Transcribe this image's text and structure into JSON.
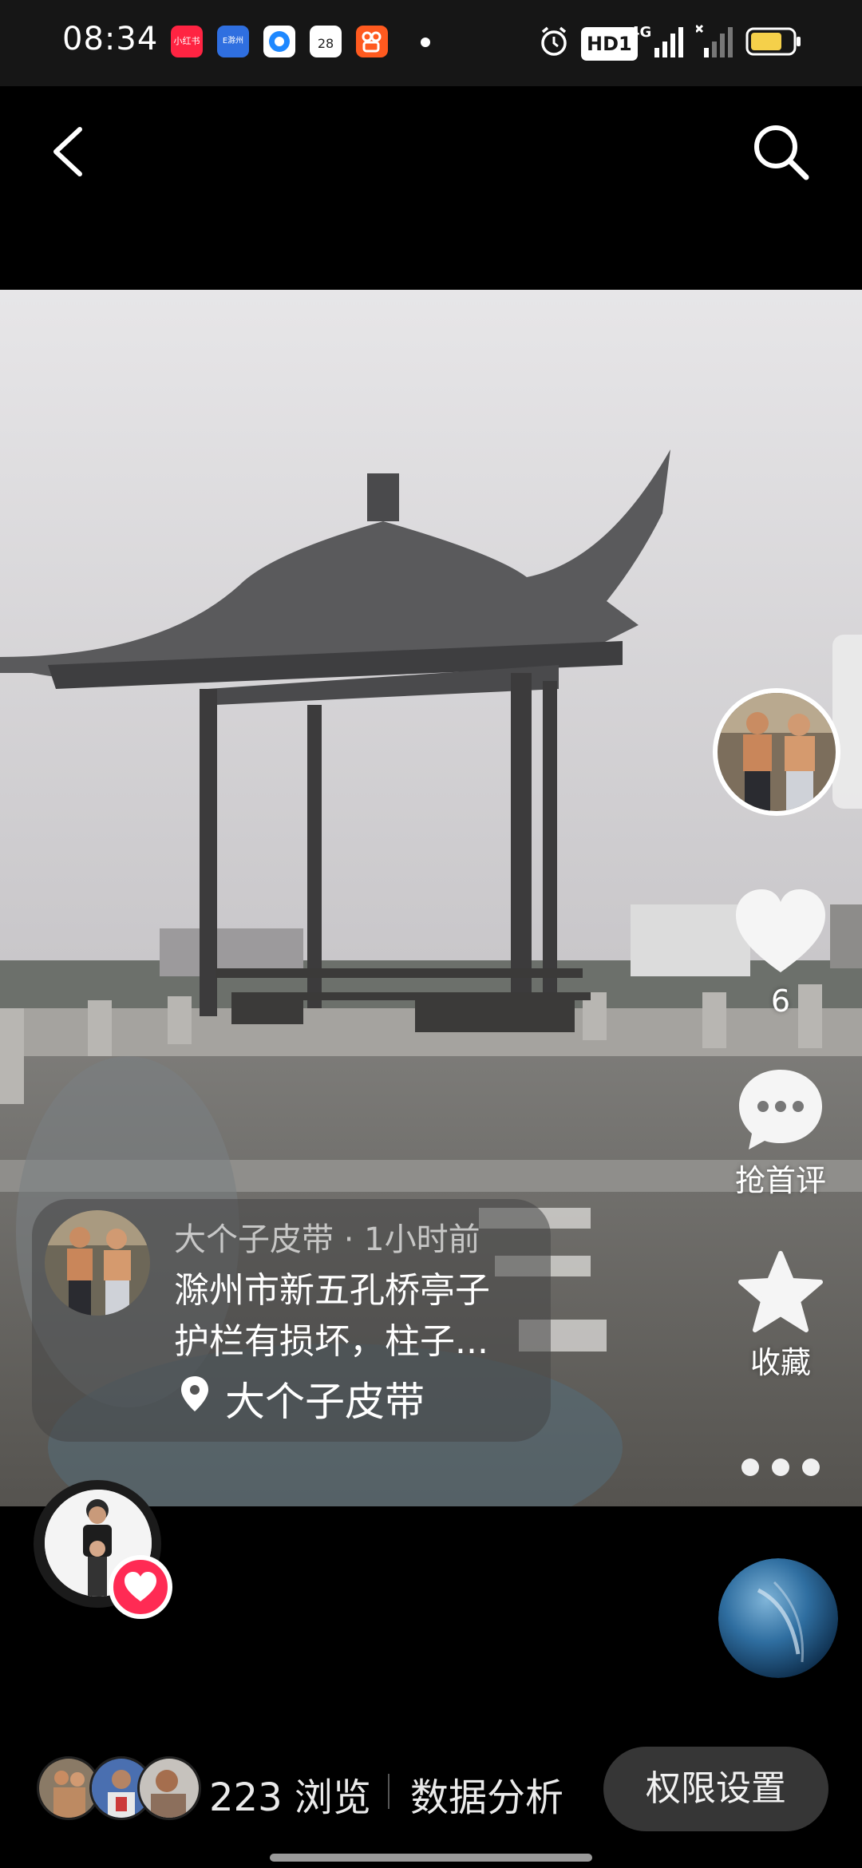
{
  "status_bar": {
    "time": "08:34",
    "apps": [
      {
        "name": "xiaohongshu-icon",
        "label": "小红书",
        "color": "#ff2442"
      },
      {
        "name": "e-chuzhou-icon",
        "label": "E滁州",
        "color": "#2f6fe0"
      },
      {
        "name": "browser-icon",
        "label": "",
        "color": "#1e88ff"
      },
      {
        "name": "calendar-icon",
        "label": "28",
        "color": "#ffffff"
      },
      {
        "name": "kuaishou-icon",
        "label": "",
        "color": "#ff5a1f"
      }
    ],
    "hd_label": "HD1",
    "network_label": "4G"
  },
  "nav": {
    "back": "back-icon",
    "search": "search-icon"
  },
  "actions": {
    "like_count": "6",
    "comment_label": "抢首评",
    "favorite_label": "收藏"
  },
  "card": {
    "meta": "大个子皮带 · 1小时前",
    "title_line1": "滁州市新五孔桥亭子",
    "title_line2": "护栏有损坏，柱子...",
    "location": "大个子皮带"
  },
  "bottom": {
    "views": "223 浏览",
    "analysis": "数据分析",
    "permission": "权限设置"
  },
  "colors": {
    "heart_badge": "#ff2b54",
    "button_bg": "#363636"
  }
}
